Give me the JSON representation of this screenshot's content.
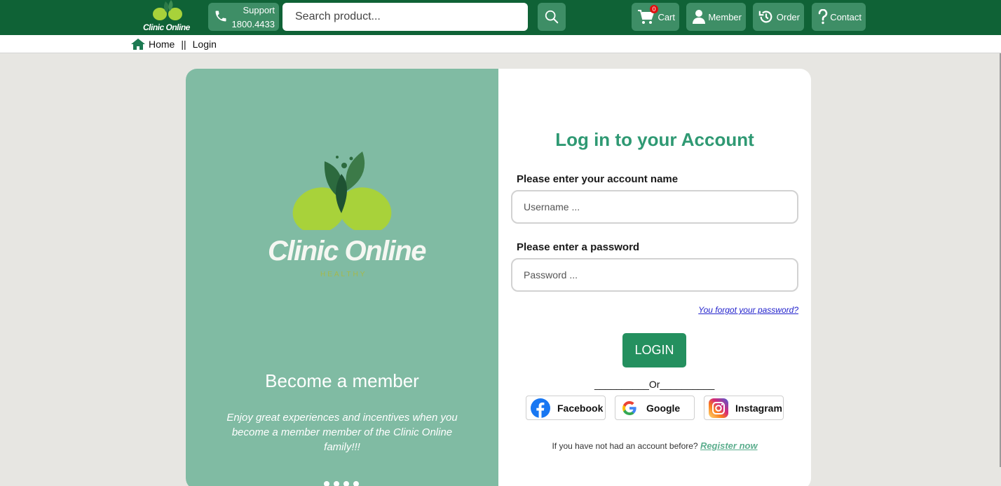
{
  "colors": {
    "header": "#0f6236",
    "accent": "#2f9973",
    "panel": "#80bba3",
    "button": "#24905f"
  },
  "header": {
    "logo_text": "Clinic Online",
    "support_label": "Support",
    "support_phone": "1800.4433",
    "search_placeholder": "Search product...",
    "cart_label": "Cart",
    "cart_count": "0",
    "member_label": "Member",
    "order_label": "Order",
    "contact_label": "Contact"
  },
  "breadcrumb": {
    "home": "Home",
    "sep": "||",
    "current": "Login"
  },
  "promo": {
    "brand": "Clinic Online",
    "tagline": "HEALTHY",
    "heading": "Become a member",
    "text": "Enjoy great experiences and incentives when you become a member member of the Clinic Online family!!!"
  },
  "form": {
    "title": "Log in to your Account",
    "username_label": "Please enter your account name",
    "username_placeholder": "Username ...",
    "password_label": "Please enter a password",
    "password_placeholder": "Password ...",
    "forgot": "You forgot your password?",
    "login": "LOGIN",
    "or": "__________Or__________",
    "facebook": "Facebook",
    "google": "Google",
    "instagram": "Instagram",
    "register_prompt": "If you have not had an account before?",
    "register_link": "Register now"
  }
}
